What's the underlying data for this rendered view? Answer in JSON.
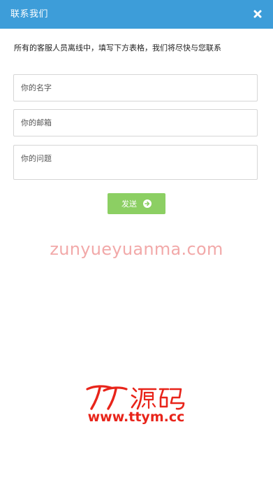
{
  "header": {
    "title": "联系我们",
    "background_color": "#3d9dd9",
    "close_icon": "close-icon"
  },
  "form": {
    "intro": "所有的客服人员离线中，填写下方表格，我们将尽快与您联系",
    "name_placeholder": "你的名字",
    "email_placeholder": "你的邮箱",
    "question_placeholder": "你的问题",
    "send_label": "发送",
    "send_icon": "arrow-right-circle-icon",
    "send_color": "#8ccf63"
  },
  "watermark": {
    "url": "zunyueyuanma.com",
    "color": "#f2a9a9"
  },
  "logo": {
    "brand": "TT源码",
    "site": "www.ttym.cc",
    "color": "#e8241a"
  }
}
